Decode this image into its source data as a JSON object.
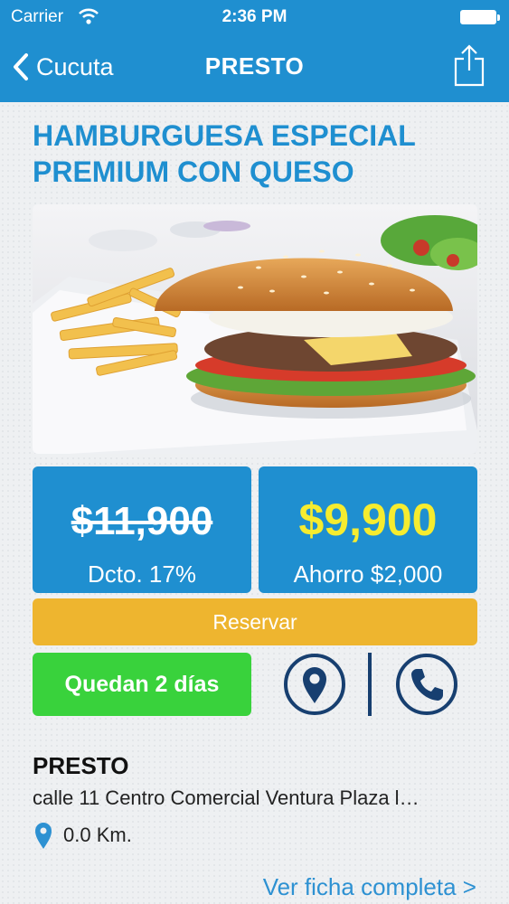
{
  "status_bar": {
    "carrier": "Carrier",
    "time": "2:36 PM",
    "icons": [
      "wifi-icon",
      "battery-icon"
    ]
  },
  "nav": {
    "back_label": "Cucuta",
    "title": "PRESTO",
    "icons": [
      "chevron-left-icon",
      "share-icon"
    ]
  },
  "product": {
    "title_line1": "HAMBURGUESA ESPECIAL",
    "title_line2": "PREMIUM CON QUESO",
    "image": "burger-with-fries-photo"
  },
  "pricing": {
    "original_price": "$11,900",
    "discount_label": "Dcto. 17%",
    "final_price": "$9,900",
    "savings_label": "Ahorro $2,000"
  },
  "actions": {
    "reserve_label": "Reservar",
    "remaining_label": "Quedan 2 días",
    "icons": [
      "location-pin-icon",
      "phone-icon"
    ]
  },
  "business": {
    "name": "PRESTO",
    "address": "calle 11 Centro Comercial Ventura Plaza l…",
    "distance": "0.0 Km.",
    "more_link": "Ver ficha completa >"
  },
  "colors": {
    "primary_blue": "#1f8fd0",
    "price_yellow": "#f6ec2f",
    "reserve_orange": "#eeb52f",
    "remaining_green": "#39d23c",
    "icon_navy": "#173f70"
  }
}
